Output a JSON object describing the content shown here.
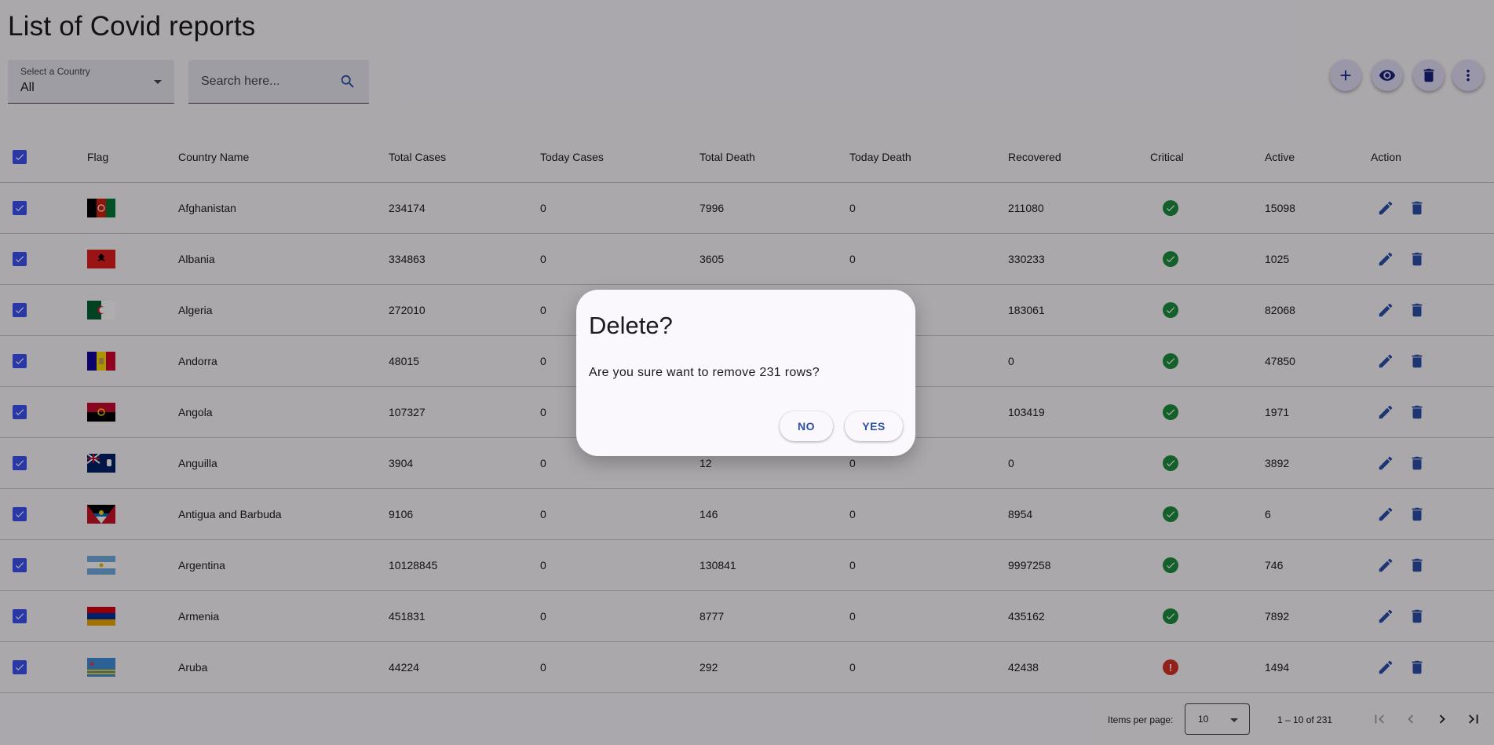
{
  "page": {
    "title": "List of Covid reports"
  },
  "filters": {
    "country_label": "Select a Country",
    "country_value": "All",
    "search_placeholder": "Search here..."
  },
  "toolbar": {
    "icons": [
      "add-icon",
      "view-icon",
      "delete-icon",
      "more-icon"
    ]
  },
  "table": {
    "headers": [
      "Flag",
      "Country Name",
      "Total Cases",
      "Today Cases",
      "Total Death",
      "Today Death",
      "Recovered",
      "Critical",
      "Active",
      "Action"
    ],
    "rows": [
      {
        "country": "Afghanistan",
        "total_cases": "234174",
        "today_cases": "0",
        "total_death": "7996",
        "today_death": "0",
        "recovered": "211080",
        "critical": "ok",
        "active": "15098",
        "flag": "af"
      },
      {
        "country": "Albania",
        "total_cases": "334863",
        "today_cases": "0",
        "total_death": "3605",
        "today_death": "0",
        "recovered": "330233",
        "critical": "ok",
        "active": "1025",
        "flag": "al"
      },
      {
        "country": "Algeria",
        "total_cases": "272010",
        "today_cases": "0",
        "total_death": "",
        "today_death": "",
        "recovered": "183061",
        "critical": "ok",
        "active": "82068",
        "flag": "dz"
      },
      {
        "country": "Andorra",
        "total_cases": "48015",
        "today_cases": "0",
        "total_death": "",
        "today_death": "",
        "recovered": "0",
        "critical": "ok",
        "active": "47850",
        "flag": "ad"
      },
      {
        "country": "Angola",
        "total_cases": "107327",
        "today_cases": "0",
        "total_death": "",
        "today_death": "",
        "recovered": "103419",
        "critical": "ok",
        "active": "1971",
        "flag": "ao"
      },
      {
        "country": "Anguilla",
        "total_cases": "3904",
        "today_cases": "0",
        "total_death": "12",
        "today_death": "0",
        "recovered": "0",
        "critical": "ok",
        "active": "3892",
        "flag": "ai"
      },
      {
        "country": "Antigua and Barbuda",
        "total_cases": "9106",
        "today_cases": "0",
        "total_death": "146",
        "today_death": "0",
        "recovered": "8954",
        "critical": "ok",
        "active": "6",
        "flag": "ag"
      },
      {
        "country": "Argentina",
        "total_cases": "10128845",
        "today_cases": "0",
        "total_death": "130841",
        "today_death": "0",
        "recovered": "9997258",
        "critical": "ok",
        "active": "746",
        "flag": "ar"
      },
      {
        "country": "Armenia",
        "total_cases": "451831",
        "today_cases": "0",
        "total_death": "8777",
        "today_death": "0",
        "recovered": "435162",
        "critical": "ok",
        "active": "7892",
        "flag": "am"
      },
      {
        "country": "Aruba",
        "total_cases": "44224",
        "today_cases": "0",
        "total_death": "292",
        "today_death": "0",
        "recovered": "42438",
        "critical": "alert",
        "active": "1494",
        "flag": "aw"
      }
    ]
  },
  "paginator": {
    "items_per_page_label": "Items per page:",
    "page_size": "10",
    "range": "1 – 10 of 231"
  },
  "dialog": {
    "title": "Delete?",
    "message": "Are you sure want to remove 231 rows?",
    "no_label": "NO",
    "yes_label": "YES"
  },
  "colors": {
    "primary": "#3f51f5",
    "ok": "#1e8e3e",
    "alert": "#d93025",
    "action": "#2b4fa8",
    "overlay": "rgba(0,0,0,0.32)"
  }
}
